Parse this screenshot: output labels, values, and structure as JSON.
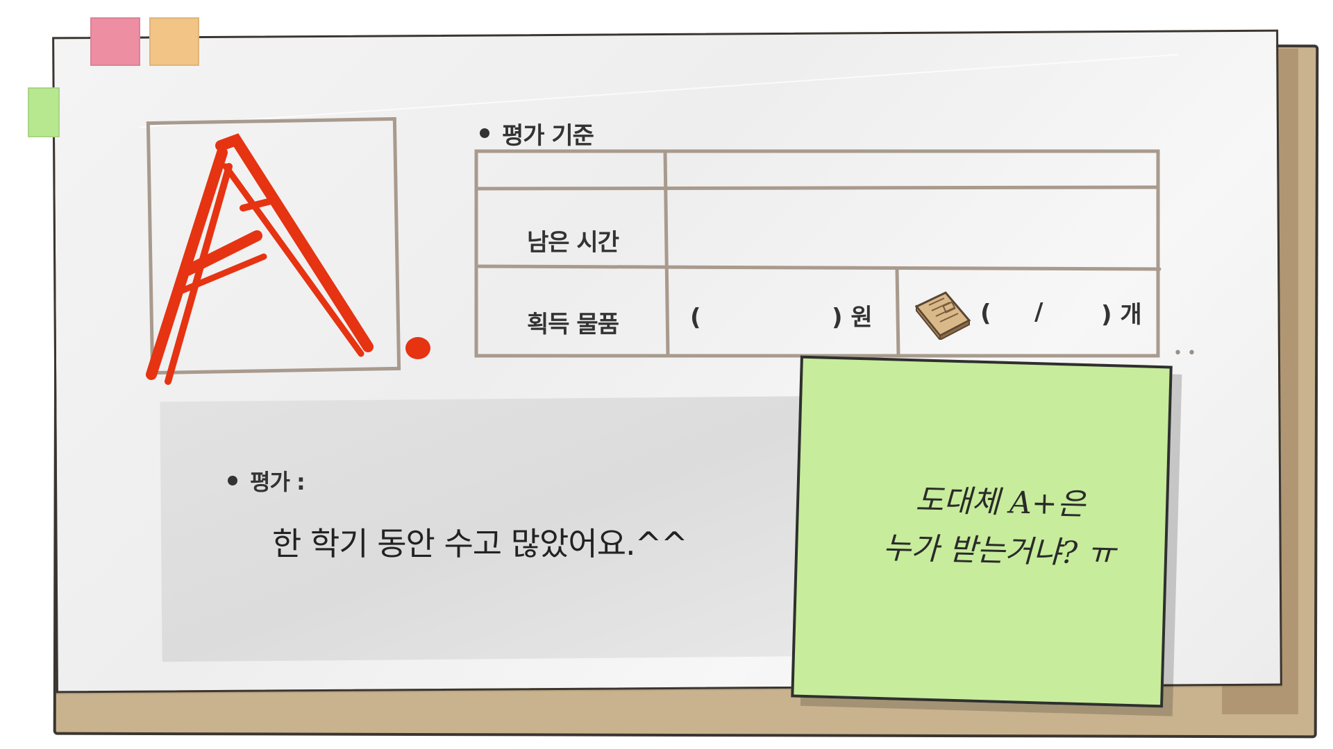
{
  "criteria": {
    "title": "평가 기준",
    "rows": [
      {
        "label": ""
      },
      {
        "label": "남은 시간"
      },
      {
        "label": "획득 물품"
      }
    ],
    "money_open": "(",
    "money_close": ") 원",
    "count_open": "(",
    "count_slash": "/",
    "count_close": ") 개",
    "item_icon": "book-icon"
  },
  "evaluation": {
    "label": "평가 :",
    "comment": "한 학기 동안 수고 많았어요.^^"
  },
  "sticky_note": {
    "text": "도대체 A+은\n누가 받는거냐? ㅠ"
  },
  "grade": {
    "letter": "A.",
    "color": "#e63312"
  },
  "colors": {
    "tab_pink": "#ee8ea2",
    "tab_orange": "#f2c485",
    "tab_green": "#b7e890",
    "sticky": "#c7ec9c",
    "grid_line": "#a89a8d"
  }
}
